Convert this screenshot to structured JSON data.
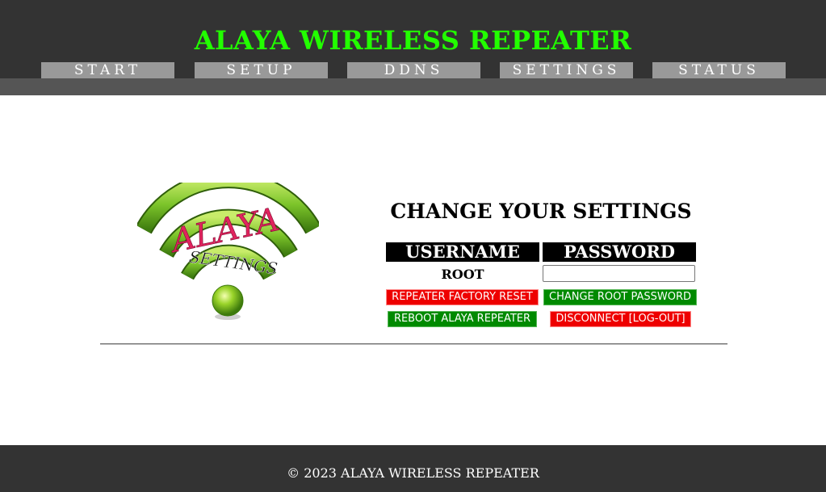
{
  "header": {
    "title": "ALAYA WIRELESS REPEATER",
    "title_color": "#22ff00",
    "nav": [
      "START",
      "SETUP",
      "DDNS",
      "SETTINGS",
      "STATUS"
    ]
  },
  "logo": {
    "brand_text": "ALAYA",
    "sub_text": "SETTINGS"
  },
  "settings": {
    "heading": "CHANGE YOUR SETTINGS",
    "col_username": "USERNAME",
    "col_password": "PASSWORD",
    "username_value": "ROOT",
    "password_value": "",
    "buttons": {
      "factory_reset": "REPEATER FACTORY RESET",
      "change_password": "CHANGE ROOT PASSWORD",
      "reboot": "REBOOT ALAYA REPEATER",
      "disconnect": "DISCONNECT [LOG-OUT]"
    }
  },
  "colors": {
    "danger": "#ee0000",
    "success": "#008a00",
    "header_bg": "#333333",
    "nav_bg": "#999999"
  },
  "footer": {
    "copyright": "© 2023 ALAYA WIRELESS REPEATER"
  }
}
